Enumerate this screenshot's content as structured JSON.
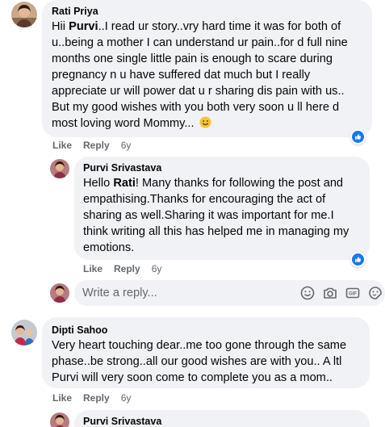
{
  "comments": [
    {
      "author": "Rati Priya",
      "lines": [
        [
          "Hii ",
          {
            "bold": "Purvi"
          },
          "..I read ur story..vry hard time it was for both of"
        ],
        [
          "u..being a mother I can understand ur pain..for d full nine"
        ],
        [
          "months one single little pain is enough to scare during"
        ],
        [
          "pregnancy n u have suffered dat much but I really"
        ],
        [
          "appreciate ur will power dat u r sharing dis pain with us.."
        ],
        [
          "But my good wishes with you both very soon u ll here d"
        ],
        [
          "most loving word Mommy... ",
          {
            "emoji": "smile"
          }
        ]
      ],
      "like_label": "Like",
      "reply_label": "Reply",
      "time": "6y",
      "reaction": "like-reaction"
    },
    {
      "author": "Purvi Srivastava",
      "lines": [
        [
          "Hello ",
          {
            "bold": "Rati"
          },
          "! Many thanks for following the post and"
        ],
        [
          "empathising.Thanks for encouraging the act of"
        ],
        [
          "sharing as well.Sharing it was important for me.I"
        ],
        [
          "think writing all this has helped me in managing my"
        ],
        [
          "emotions."
        ]
      ],
      "like_label": "Like",
      "reply_label": "Reply",
      "time": "6y",
      "reaction": "like-reaction"
    },
    {
      "author": "Dipti Sahoo",
      "lines": [
        [
          "Very heart touching dear..me too gone through the same"
        ],
        [
          "phase..be strong..all our good wishes are with you.. A ltl"
        ],
        [
          "Purvi will very soon come to complete you as a mom.."
        ]
      ],
      "like_label": "Like",
      "reply_label": "Reply",
      "time": "6y"
    },
    {
      "author": "Purvi Srivastava",
      "lines": []
    }
  ],
  "composer": {
    "placeholder": "Write a reply...",
    "icons": [
      "emoji-icon",
      "camera-icon",
      "gif-icon",
      "sticker-icon"
    ]
  },
  "colors": {
    "bubble": "#f0f2f5",
    "meta_text": "#65676b",
    "like_blue": "#1877f2",
    "text": "#050505"
  }
}
